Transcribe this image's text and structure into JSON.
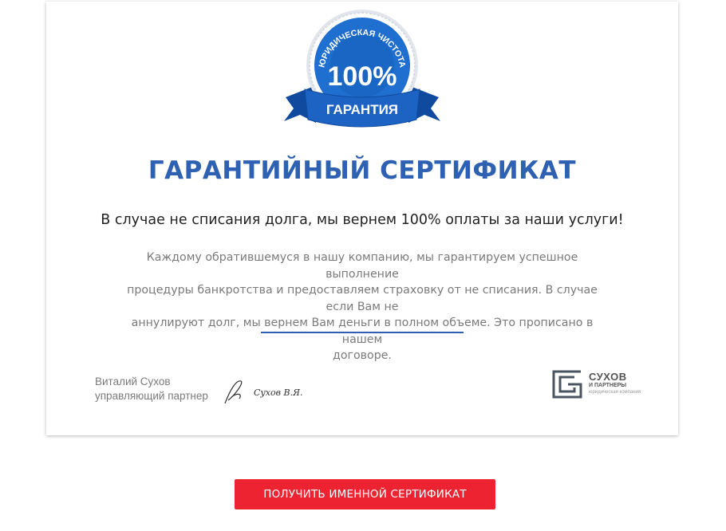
{
  "certificate": {
    "badge": {
      "arc_text": "ЮРИДИЧЕСКАЯ ЧИСТОТА",
      "percent": "100%",
      "ribbon_text": "ГАРАНТИЯ",
      "colors": {
        "blue": "#1e6fd0",
        "dark_blue": "#0f4a9e",
        "ribbon": "#1d63c4"
      }
    },
    "title": "ГАРАНТИЙНЫЙ СЕРТИФИКАТ",
    "subtitle": "В случае не списания долга, мы вернем 100% оплаты за наши услуги!",
    "description_lines": [
      "Каждому обратившемуся в нашу компанию, мы гарантируем успешное выполнение",
      "процедуры банкротства и предоставляем страховку от не списания. В случае если Вам не",
      "аннулируют долг, мы вернем Вам деньги в полном объеме. Это прописано в нашем",
      "договоре."
    ],
    "signer": {
      "name": "Виталий Сухов",
      "role": "управляющий партнер",
      "signature": "Сухов В.Я."
    },
    "company": {
      "name": "СУХОВ",
      "subname": "И ПАРТНЕРЫ",
      "tagline": "юридическая компания"
    },
    "accent_color": "#2f61b3"
  },
  "cta": {
    "label": "ПОЛУЧИТЬ ИМЕННОЙ СЕРТИФИКАТ",
    "color": "#ed2332"
  }
}
